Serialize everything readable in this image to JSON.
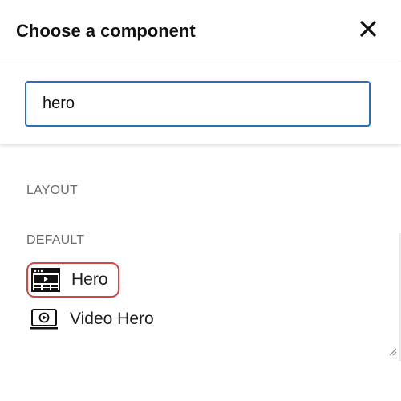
{
  "dialog": {
    "title": "Choose a component",
    "close_icon": "close-icon"
  },
  "search": {
    "value": "hero",
    "placeholder": ""
  },
  "sections": [
    {
      "label": "LAYOUT",
      "items": []
    },
    {
      "label": "DEFAULT",
      "items": [
        {
          "label": "Hero",
          "icon": "hero-layout-icon",
          "highlighted": true
        },
        {
          "label": "Video Hero",
          "icon": "video-hero-icon",
          "highlighted": false
        }
      ]
    }
  ],
  "colors": {
    "input_border": "#2e6db4",
    "highlight_border": "#d64545",
    "section_label": "#6b6b6b"
  }
}
